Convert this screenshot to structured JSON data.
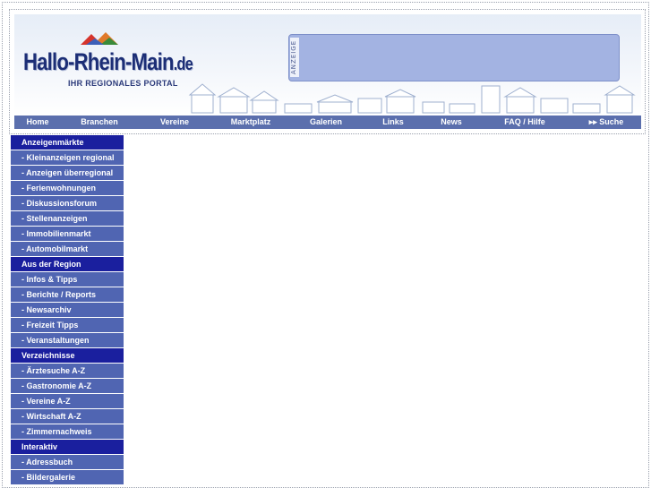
{
  "logo": {
    "main": "Hallo-Rhein-Main",
    "tld": ".de",
    "slogan": "IHR REGIONALES PORTAL"
  },
  "ad": {
    "label": "ANZEIGE"
  },
  "nav": [
    {
      "label": "Home"
    },
    {
      "label": "Branchen"
    },
    {
      "label": "Vereine"
    },
    {
      "label": "Marktplatz"
    },
    {
      "label": "Galerien"
    },
    {
      "label": "Links"
    },
    {
      "label": "News"
    },
    {
      "label": "FAQ / Hilfe"
    },
    {
      "label": "▸▸ Suche"
    }
  ],
  "sidebar": [
    {
      "type": "head",
      "label": "Anzeigenmärkte"
    },
    {
      "type": "item",
      "label": "- Kleinanzeigen regional"
    },
    {
      "type": "item",
      "label": "- Anzeigen überregional"
    },
    {
      "type": "item",
      "label": "- Ferienwohnungen"
    },
    {
      "type": "item",
      "label": "- Diskussionsforum"
    },
    {
      "type": "item",
      "label": "- Stellenanzeigen"
    },
    {
      "type": "item",
      "label": "- Immobilienmarkt"
    },
    {
      "type": "item",
      "label": "- Automobilmarkt"
    },
    {
      "type": "head",
      "label": "Aus der Region"
    },
    {
      "type": "item",
      "label": "- Infos & Tipps"
    },
    {
      "type": "item",
      "label": "- Berichte / Reports"
    },
    {
      "type": "item",
      "label": "- Newsarchiv"
    },
    {
      "type": "item",
      "label": "- Freizeit Tipps"
    },
    {
      "type": "item",
      "label": "- Veranstaltungen"
    },
    {
      "type": "head",
      "label": "Verzeichnisse"
    },
    {
      "type": "item",
      "label": "- Ärztesuche A-Z"
    },
    {
      "type": "item",
      "label": "- Gastronomie A-Z"
    },
    {
      "type": "item",
      "label": "- Vereine A-Z"
    },
    {
      "type": "item",
      "label": "- Wirtschaft A-Z"
    },
    {
      "type": "item",
      "label": "- Zimmernachweis"
    },
    {
      "type": "head",
      "label": "Interaktiv"
    },
    {
      "type": "item",
      "label": "- Adressbuch"
    },
    {
      "type": "item",
      "label": "- Bildergalerie"
    }
  ]
}
